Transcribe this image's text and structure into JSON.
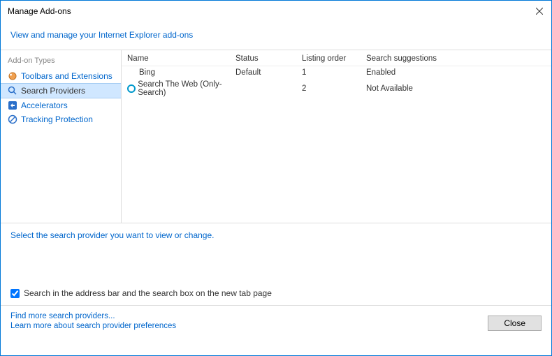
{
  "title": "Manage Add-ons",
  "header_link": "View and manage your Internet Explorer add-ons",
  "sidebar": {
    "heading": "Add-on Types",
    "items": [
      {
        "label": "Toolbars and Extensions"
      },
      {
        "label": "Search Providers"
      },
      {
        "label": "Accelerators"
      },
      {
        "label": "Tracking Protection"
      }
    ]
  },
  "columns": {
    "name": "Name",
    "status": "Status",
    "order": "Listing order",
    "sugg": "Search suggestions"
  },
  "rows": [
    {
      "name": "Bing",
      "status": "Default",
      "order": "1",
      "sugg": "Enabled",
      "icon": "none"
    },
    {
      "name": "Search The Web (Only-Search)",
      "status": "",
      "order": "2",
      "sugg": "Not Available",
      "icon": "circle"
    }
  ],
  "instruction": "Select the search provider you want to view or change.",
  "checkbox_label": "Search in the address bar and the search box on the new tab page",
  "footer": {
    "find_link": "Find more search providers...",
    "learn_link": "Learn more about search provider preferences",
    "close_button": "Close"
  }
}
